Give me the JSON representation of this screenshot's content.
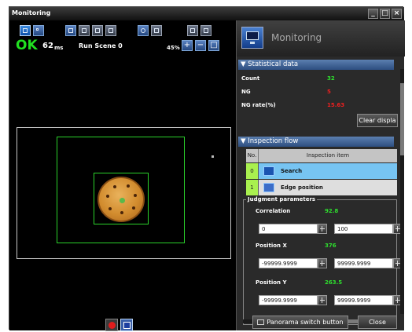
{
  "window": {
    "title": "Monitoring",
    "controls": [
      "minimize-icon",
      "maximize-icon",
      "close-icon"
    ]
  },
  "left": {
    "toolbar_icons": [
      "single-view-icon",
      "multi-view-icon",
      "layout-1-icon",
      "layout-2-icon",
      "layout-3-icon",
      "layout-4-icon",
      "camera-icon",
      "image-icon",
      "grid-icon",
      "zoom-window-icon"
    ],
    "result": "OK",
    "time_value": "62",
    "time_unit": "ms",
    "scene": "Run Scene 0",
    "zoom": "45%",
    "zoom_icons": [
      "zoom-in-icon",
      "zoom-out-icon",
      "fit-icon"
    ]
  },
  "right": {
    "title": "Monitoring",
    "statistical": {
      "heading": "Statistical data",
      "count_label": "Count",
      "count_value": "32",
      "ng_label": "NG",
      "ng_value": "5",
      "ng_rate_label": "NG rate(%)",
      "ng_rate_value": "15.63",
      "clear_button": "Clear displa"
    },
    "flow": {
      "heading": "Inspection flow",
      "col_no": "No.",
      "col_item": "Inspection item",
      "rows": [
        {
          "no": "0",
          "label": "Search"
        },
        {
          "no": "1",
          "label": "Edge position"
        }
      ]
    },
    "judgment": {
      "title": "Judgment parameters",
      "correlation_label": "Correlation",
      "correlation_value": "92.8",
      "correlation_min": "0",
      "correlation_max": "100",
      "posx_label": "Position X",
      "posx_value": "376",
      "posx_min": "-99999.9999",
      "posx_max": "99999.9999",
      "posy_label": "Position Y",
      "posy_value": "263.5",
      "posy_min": "-99999.9999",
      "posy_max": "99999.9999"
    },
    "panorama_button": "Panorama switch button",
    "close_button": "Close"
  },
  "colors": {
    "ok_green": "#21e021",
    "ng_red": "#ee1f1f",
    "section_blue": "#3d6298",
    "selected_row": "#77c4f2"
  }
}
